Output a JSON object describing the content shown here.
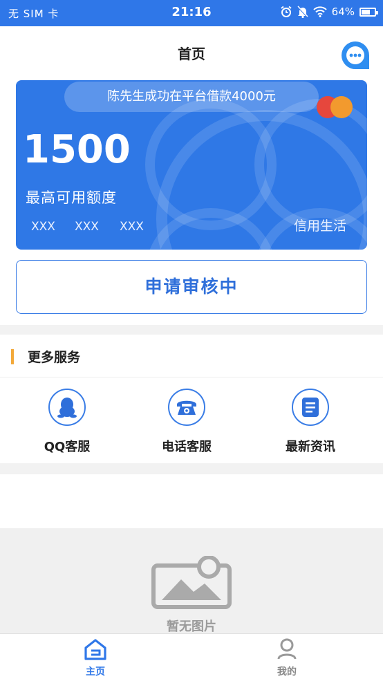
{
  "status_bar": {
    "carrier": "无 SIM 卡",
    "time": "21:16",
    "battery_text": "64%",
    "battery_level": 0.64
  },
  "header": {
    "title": "首页",
    "chat_icon": "chat-bubble-icon"
  },
  "card": {
    "notice": "陈先生成功在平台借款4000元",
    "amount": "1500",
    "limit_label": "最高可用额度",
    "masked": [
      "XXX",
      "XXX",
      "XXX"
    ],
    "brand": "信用生活"
  },
  "review_button": "申请审核中",
  "services": {
    "title": "更多服务",
    "items": [
      {
        "label": "QQ客服",
        "icon": "qq-penguin-icon"
      },
      {
        "label": "电话客服",
        "icon": "telephone-icon"
      },
      {
        "label": "最新资讯",
        "icon": "news-document-icon"
      }
    ]
  },
  "image_placeholder": {
    "text": "暂无图片",
    "icon": "image-placeholder-icon"
  },
  "tabbar": {
    "items": [
      {
        "label": "主页",
        "icon": "home-icon",
        "active": true
      },
      {
        "label": "我的",
        "icon": "profile-icon",
        "active": false
      }
    ]
  },
  "colors": {
    "primary": "#2f77e8",
    "accent": "#f3a93a",
    "inactive": "#888888"
  }
}
